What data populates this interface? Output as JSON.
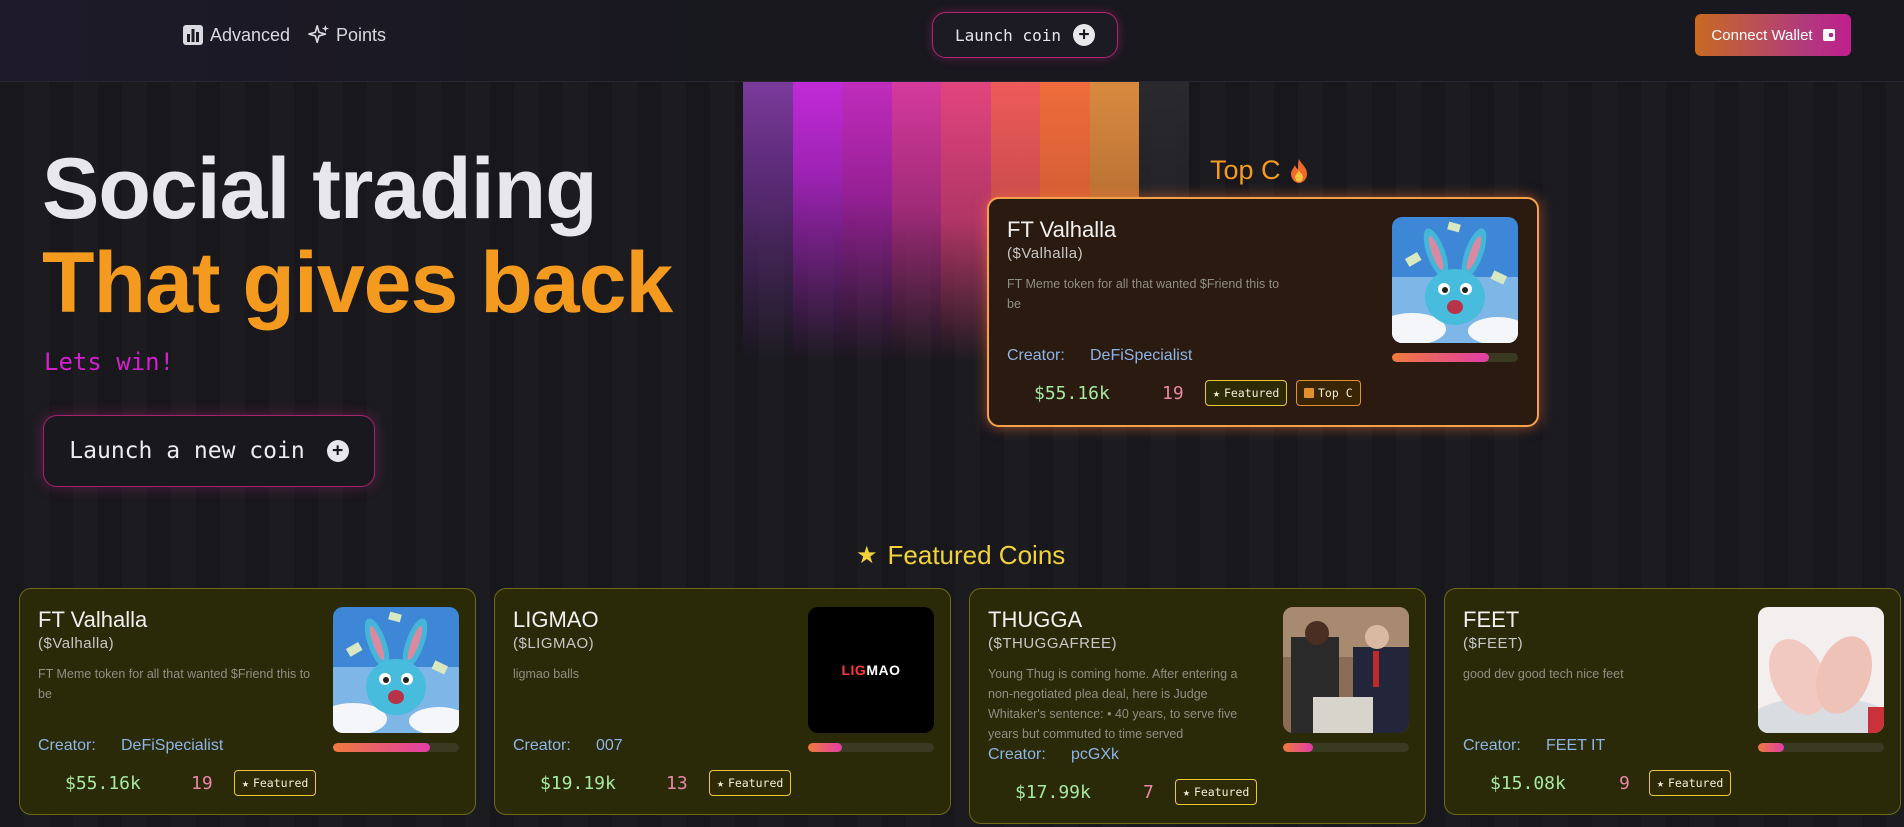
{
  "header": {
    "nav": [
      {
        "label": "Advanced",
        "icon": "bar-chart-icon"
      },
      {
        "label": "Points",
        "icon": "sparkle-icon"
      }
    ],
    "launch_label": "Launch coin",
    "connect_label": "Connect Wallet"
  },
  "hero": {
    "line1": "Social trading",
    "line2": "That gives back",
    "subtitle": "Lets win!",
    "launch_button": "Launch a new coin"
  },
  "top": {
    "title": "Top C",
    "coin": {
      "name": "FT Valhalla",
      "ticker": "($Valhalla)",
      "description": "FT Meme token for all that wanted $Friend this to be",
      "creator_label": "Creator:",
      "creator": "DeFiSpecialist",
      "market_cap": "$55.16k",
      "replies": "19",
      "badge_featured": "Featured",
      "badge_top": "Top C",
      "progress": 0.77
    }
  },
  "featured": {
    "title": "Featured Coins",
    "coins": [
      {
        "name": "FT Valhalla",
        "ticker": "($Valhalla)",
        "description": "FT Meme token for all that wanted $Friend this to be",
        "creator_label": "Creator:",
        "creator": "DeFiSpecialist",
        "market_cap": "$55.16k",
        "replies": "19",
        "badge": "Featured",
        "progress": 0.77,
        "image": "bunny-image"
      },
      {
        "name": "LIGMAO",
        "ticker": "($LIGMAO)",
        "description": "ligmao balls",
        "creator_label": "Creator:",
        "creator": "007",
        "market_cap": "$19.19k",
        "replies": "13",
        "badge": "Featured",
        "progress": 0.27,
        "image": "ligmao-logo",
        "logo_text_a": "LIG",
        "logo_text_b": "MAO"
      },
      {
        "name": "THUGGA",
        "ticker": "($THUGGAFREE)",
        "description": "Young Thug is coming home. After entering a non-negotiated plea deal, here is Judge Whitaker's sentence: • 40 years, to serve five years but commuted to time served",
        "creator_label": "Creator:",
        "creator": "pcGXk",
        "market_cap": "$17.99k",
        "replies": "7",
        "badge": "Featured",
        "progress": 0.24,
        "image": "courtroom-photo"
      },
      {
        "name": "FEET",
        "ticker": "($FEET)",
        "description": "good dev good tech nice feet",
        "creator_label": "Creator:",
        "creator": "FEET IT",
        "market_cap": "$15.08k",
        "replies": "9",
        "badge": "Featured",
        "progress": 0.21,
        "image": "feet-photo"
      }
    ]
  },
  "colors": {
    "accent_orange": "#f39a1f",
    "accent_magenta": "#d21fd0",
    "featured_yellow": "#f2d23a",
    "mcap_green": "#a6e9a0",
    "replies_pink": "#e987a6",
    "creator_blue": "#8fb4e6"
  }
}
